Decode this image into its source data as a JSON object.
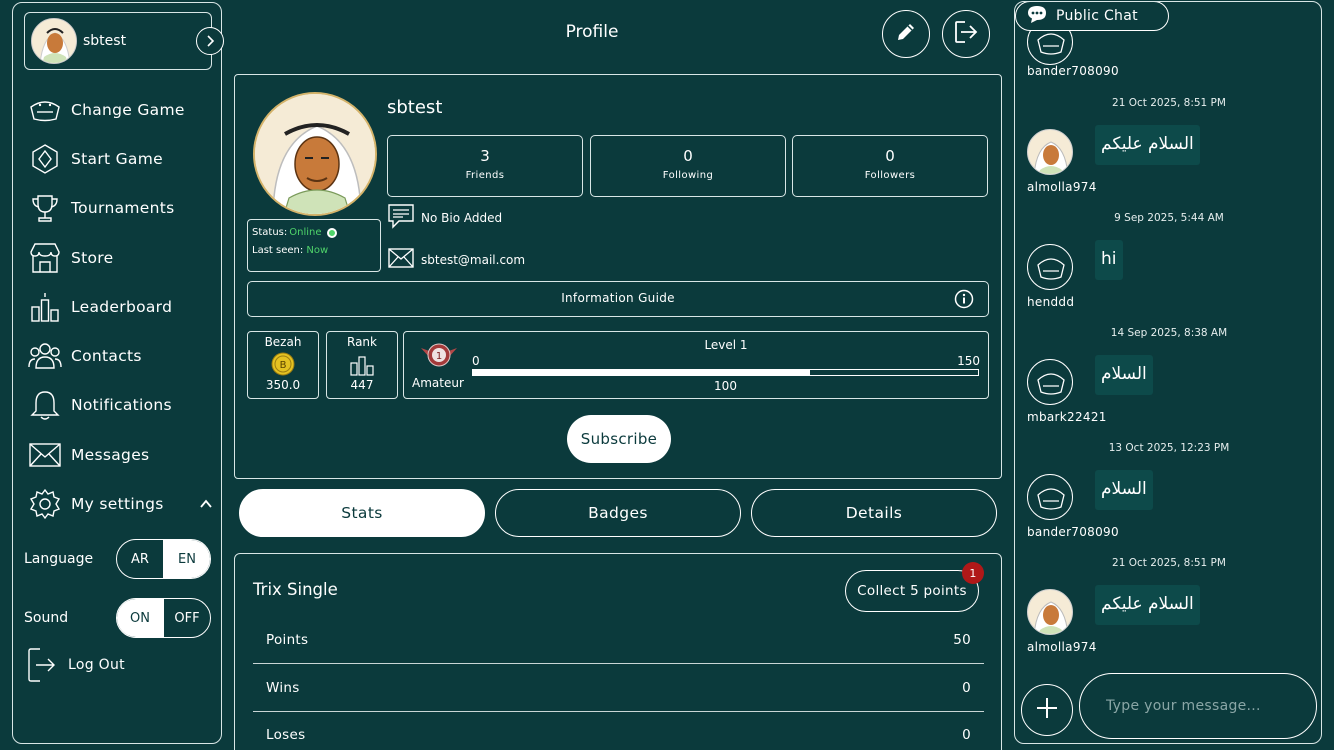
{
  "sidebar": {
    "user": {
      "name": "sbtest"
    },
    "items": [
      {
        "label": "Change Game",
        "icon": "trix-logo-icon"
      },
      {
        "label": "Start Game",
        "icon": "game-cards-icon"
      },
      {
        "label": "Tournaments",
        "icon": "trophy-icon"
      },
      {
        "label": "Store",
        "icon": "store-icon"
      },
      {
        "label": "Leaderboard",
        "icon": "leaderboard-icon"
      },
      {
        "label": "Contacts",
        "icon": "contacts-icon"
      },
      {
        "label": "Notifications",
        "icon": "bell-icon"
      },
      {
        "label": "Messages",
        "icon": "envelope-icon"
      },
      {
        "label": "My settings",
        "icon": "gear-icon"
      }
    ],
    "language": {
      "label": "Language",
      "options": [
        "AR",
        "EN"
      ],
      "selected": "EN"
    },
    "sound": {
      "label": "Sound",
      "options": [
        "ON",
        "OFF"
      ],
      "selected": "ON"
    },
    "logout": "Log Out"
  },
  "header": {
    "title": "Profile"
  },
  "profile": {
    "name": "sbtest",
    "stats": [
      {
        "value": "3",
        "label": "Friends"
      },
      {
        "value": "0",
        "label": "Following"
      },
      {
        "value": "0",
        "label": "Followers"
      }
    ],
    "status_label": "Status:",
    "status_value": "Online",
    "last_seen_label": "Last seen:",
    "last_seen_value": "Now",
    "bio": "No Bio Added",
    "email": "sbtest@mail.com",
    "info_guide": "Information Guide",
    "bezah": {
      "label": "Bezah",
      "value": "350.0"
    },
    "rank": {
      "label": "Rank",
      "value": "447"
    },
    "level": {
      "title": "Level 1",
      "tier": "Amateur",
      "min": "0",
      "max": "150",
      "current": "100",
      "progress": 0.667
    },
    "subscribe": "Subscribe"
  },
  "tabs": [
    {
      "label": "Stats",
      "active": true
    },
    {
      "label": "Badges",
      "active": false
    },
    {
      "label": "Details",
      "active": false
    }
  ],
  "stats_card": {
    "title": "Trix Single",
    "collect_label": "Collect 5 points",
    "collect_badge": "1",
    "rows": [
      {
        "key": "Points",
        "value": "50"
      },
      {
        "key": "Wins",
        "value": "0"
      },
      {
        "key": "Loses",
        "value": "0"
      }
    ]
  },
  "chat": {
    "title": "Public Chat",
    "messages": [
      {
        "user": "bander708090",
        "time": "",
        "text": "",
        "avatar": "logo"
      },
      {
        "user": "almolla974",
        "time": "21 Oct 2025, 8:51 PM",
        "text": "السلام عليكم",
        "avatar": "face"
      },
      {
        "user": "henddd",
        "time": "9 Sep 2025, 5:44 AM",
        "text": "hi",
        "avatar": "logo"
      },
      {
        "user": "mbark22421",
        "time": "14 Sep 2025, 8:38 AM",
        "text": "السلام",
        "avatar": "logo"
      },
      {
        "user": "bander708090",
        "time": "13 Oct 2025, 12:23 PM",
        "text": "السلام",
        "avatar": "logo"
      },
      {
        "user": "almolla974",
        "time": "21 Oct 2025, 8:51 PM",
        "text": "السلام عليكم",
        "avatar": "face"
      }
    ],
    "input_placeholder": "Type your message..."
  },
  "colors": {
    "background": "#0b3a3c",
    "online": "#4fd36a",
    "badge": "#b01818",
    "accent_gold": "#d4b36a"
  }
}
